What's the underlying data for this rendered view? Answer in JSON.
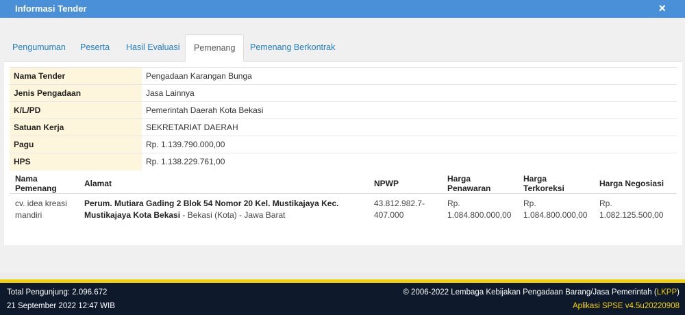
{
  "window": {
    "title": "Informasi Tender",
    "close_icon": "×"
  },
  "tabs": [
    {
      "label": "Pengumuman"
    },
    {
      "label": "Peserta"
    },
    {
      "label": "Hasil Evaluasi"
    },
    {
      "label": "Pemenang",
      "active": true
    },
    {
      "label": "Pemenang Berkontrak"
    }
  ],
  "info": [
    {
      "label": "Nama Tender",
      "value": "Pengadaan Karangan Bunga"
    },
    {
      "label": "Jenis Pengadaan",
      "value": "Jasa Lainnya"
    },
    {
      "label": "K/L/PD",
      "value": "Pemerintah Daerah Kota Bekasi"
    },
    {
      "label": "Satuan Kerja",
      "value": "SEKRETARIAT DAERAH"
    },
    {
      "label": "Pagu",
      "value": "Rp. 1.139.790.000,00"
    },
    {
      "label": "HPS",
      "value": "Rp. 1.138.229.761,00"
    }
  ],
  "winners": {
    "headers": [
      "Nama Pemenang",
      "Alamat",
      "NPWP",
      "Harga Penawaran",
      "Harga Terkoreksi",
      "Harga Negosiasi"
    ],
    "rows": [
      {
        "nama_line1": "cv. idea kreasi",
        "nama_line2": "mandiri",
        "alamat_bold_line1": "Perum. Mutiara Gading 2 Blok 54 Nomor 20 Kel. Mustikajaya Kec.",
        "alamat_bold_line2": "Mustikajaya Kota Bekasi",
        "alamat_rest": " - Bekasi (Kota) - Jawa Barat",
        "npwp_line1": "43.812.982.7-",
        "npwp_line2": "407.000",
        "penawaran_line1": "Rp.",
        "penawaran_line2": "1.084.800.000,00",
        "terkoreksi_line1": "Rp.",
        "terkoreksi_line2": "1.084.800.000,00",
        "negosiasi_line1": "Rp.",
        "negosiasi_line2": "1.082.125.500,00"
      }
    ]
  },
  "footer": {
    "visitors": "Total Pengunjung: 2.096.672",
    "datetime": "21 September 2022 12:47 WIB",
    "copyright_prefix": "© 2006-2022 Lembaga Kebijakan Pengadaan Barang/Jasa Pemerintah (",
    "copyright_link": "LKPP",
    "copyright_suffix": ")",
    "app_version": "Aplikasi SPSE v4.5u20220908"
  },
  "colors": {
    "titlebar": "#4a90d9",
    "tab_link": "#1f7fc1",
    "label_bg": "#fdf6dc",
    "footer_bg": "#0e1a2b",
    "footer_accent": "#f5d000"
  }
}
